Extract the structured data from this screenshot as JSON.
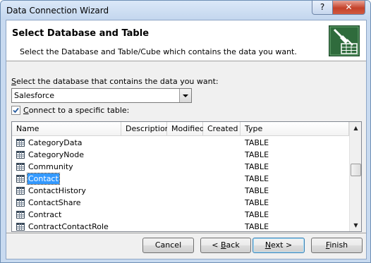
{
  "window": {
    "title": "Data Connection Wizard",
    "help_label": "?",
    "close_label": "✕"
  },
  "header": {
    "title": "Select Database and Table",
    "subtitle": "Select the Database and Table/Cube which contains the data you want.",
    "icon": "database-wizard-icon"
  },
  "database": {
    "label_prefix": "S",
    "label_rest": "elect the database that contains the data you want:",
    "selected": "Salesforce",
    "arrow": "▼"
  },
  "connect": {
    "checked": true,
    "check_glyph": "✓",
    "label_prefix": "C",
    "label_rest": "onnect to a specific table:"
  },
  "list": {
    "columns": [
      "Name",
      "Description",
      "Modified",
      "Created",
      "Type"
    ],
    "rows": [
      {
        "name": "CategoryData",
        "type": "TABLE",
        "selected": false
      },
      {
        "name": "CategoryNode",
        "type": "TABLE",
        "selected": false
      },
      {
        "name": "Community",
        "type": "TABLE",
        "selected": false
      },
      {
        "name": "Contact",
        "type": "TABLE",
        "selected": true
      },
      {
        "name": "ContactHistory",
        "type": "TABLE",
        "selected": false
      },
      {
        "name": "ContactShare",
        "type": "TABLE",
        "selected": false
      },
      {
        "name": "Contract",
        "type": "TABLE",
        "selected": false
      },
      {
        "name": "ContractContactRole",
        "type": "TABLE",
        "selected": false
      }
    ],
    "scroll_up": "▲",
    "scroll_down": "▼"
  },
  "buttons": {
    "cancel": "Cancel",
    "back_prefix": "< ",
    "back_key": "B",
    "back_rest": "ack",
    "next_key": "N",
    "next_rest": "ext >",
    "finish_key": "F",
    "finish_rest": "inish"
  }
}
